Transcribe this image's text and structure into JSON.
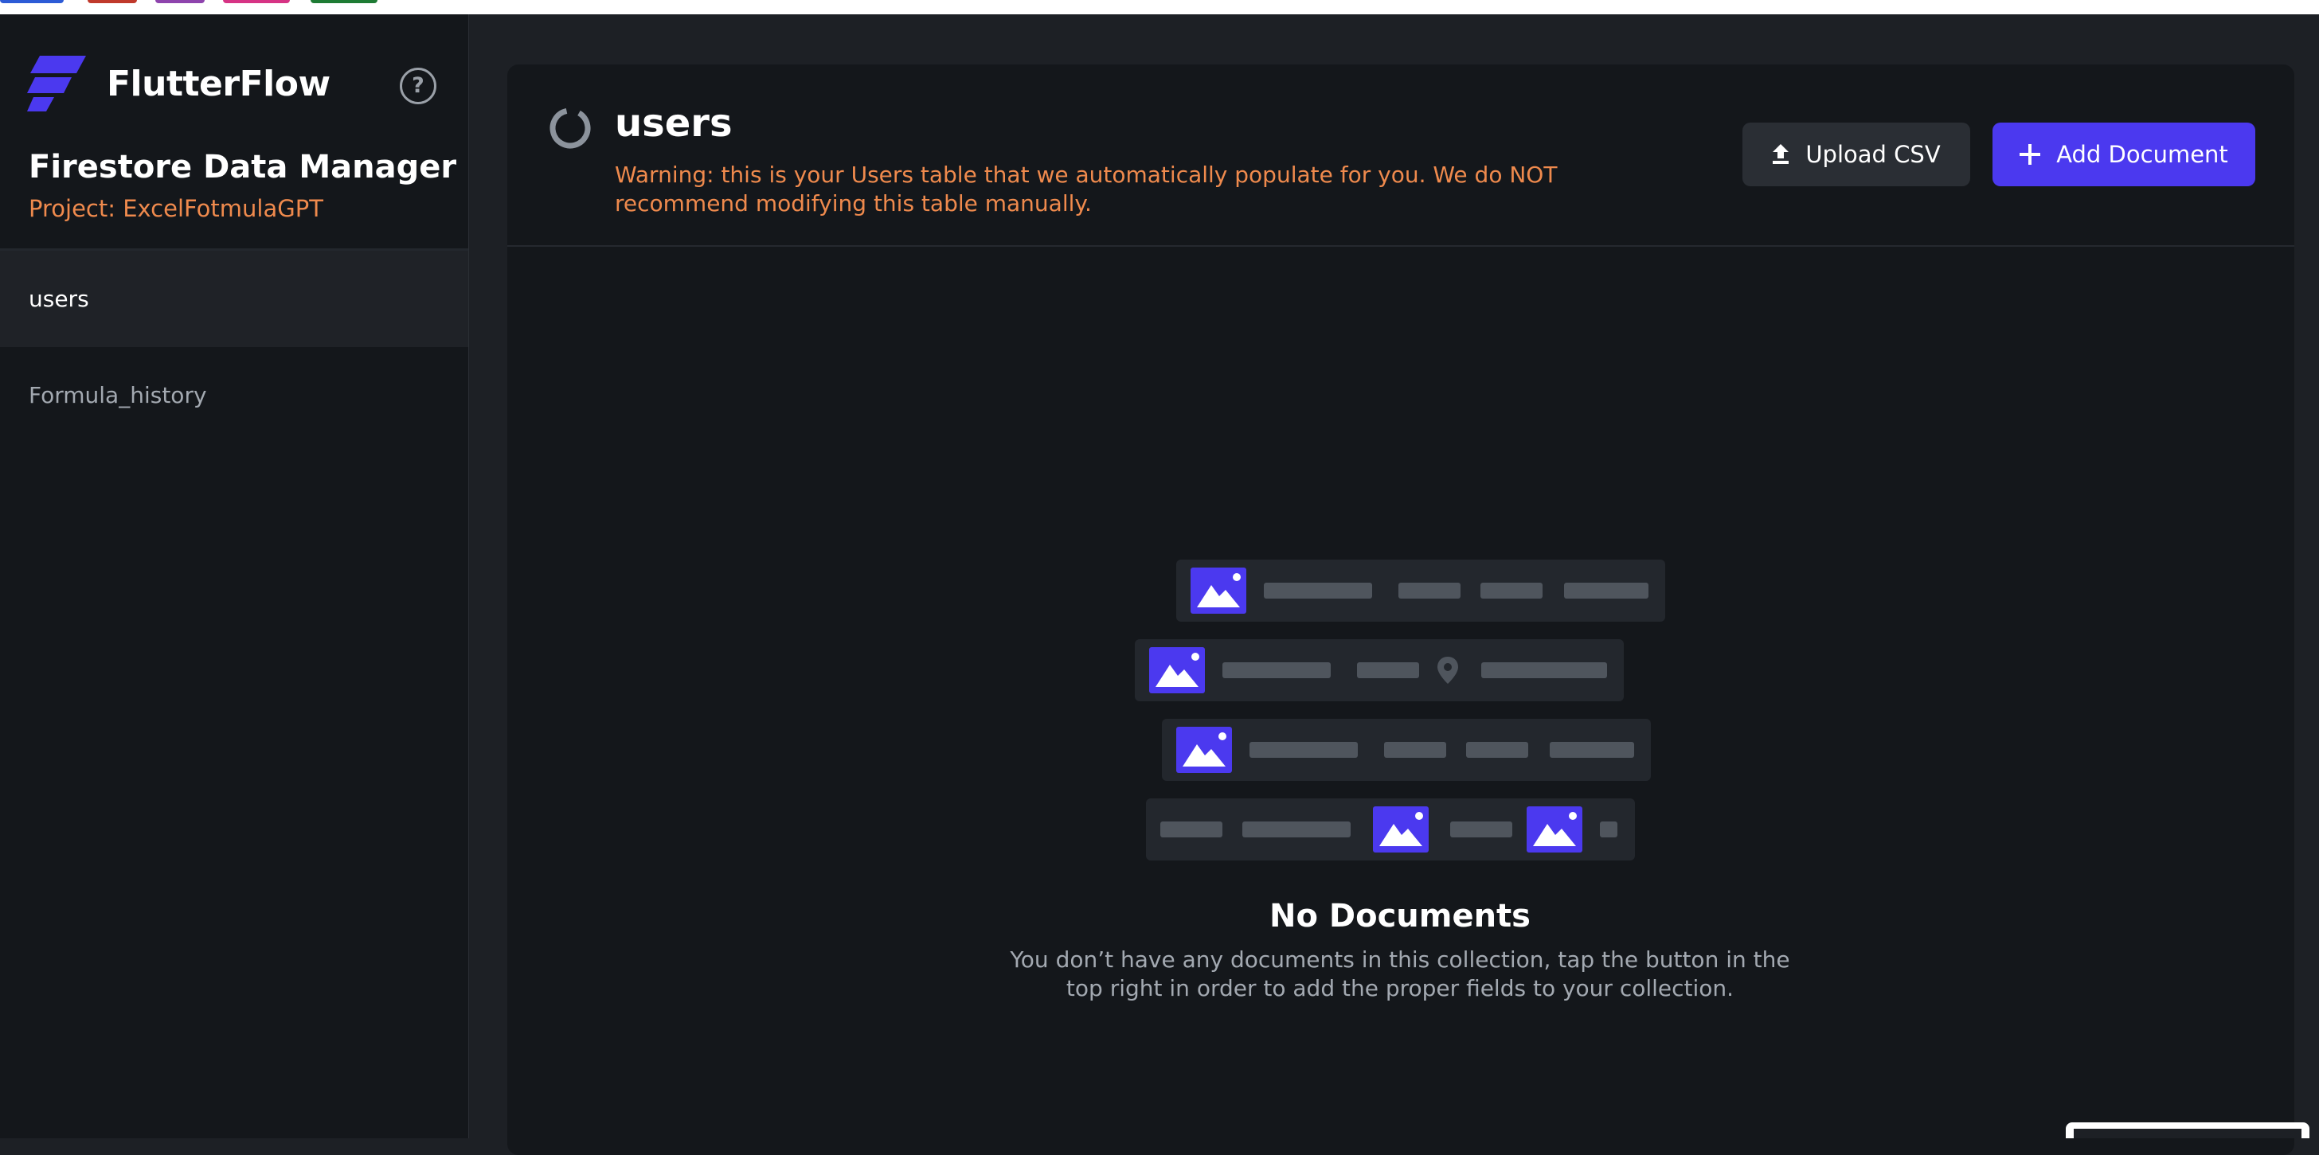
{
  "browser": {
    "tab_colors": [
      "#2d5bd6",
      "#c0392b",
      "#8e44ad",
      "#d63384",
      "#1e7b34"
    ]
  },
  "sidebar": {
    "brand_name": "FlutterFlow",
    "app_title": "Firestore Data Manager",
    "project_label": "Project: ExcelFotmulaGPT",
    "help_label": "?",
    "items": [
      {
        "label": "users",
        "active": true
      },
      {
        "label": "Formula_history",
        "active": false
      }
    ]
  },
  "main": {
    "collection_title": "users",
    "warning": "Warning: this is your Users table that we automatically populate for you. We do NOT recommend modifying this table manually.",
    "upload_button_label": "Upload CSV",
    "add_button_label": "Add Document",
    "empty_state": {
      "title": "No Documents",
      "description": "You don’t have any documents in this collection, tap the button in the top right in order to add the proper fields to your collection."
    }
  },
  "colors": {
    "accent": "#4b39ef",
    "warning": "#ef8a4d",
    "background": "#1d2025",
    "panel": "#14171b"
  }
}
